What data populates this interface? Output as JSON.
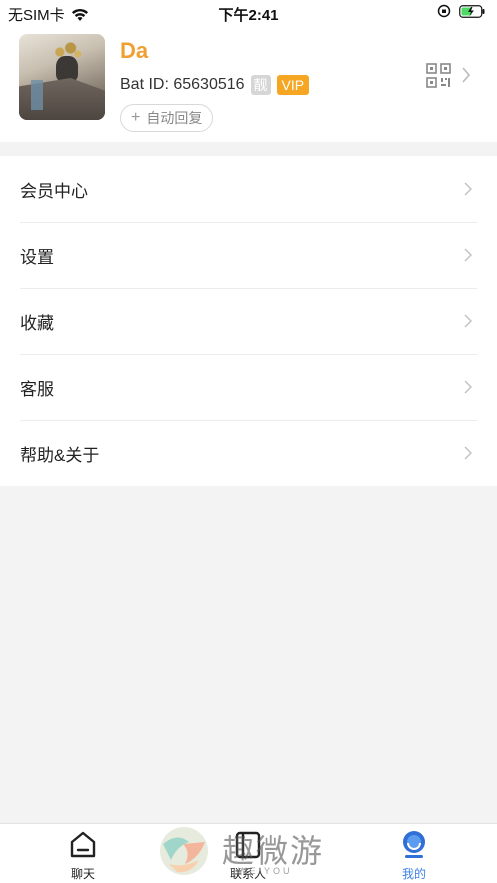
{
  "status_bar": {
    "carrier": "无SIM卡",
    "time": "下午2:41"
  },
  "profile": {
    "name": "Da",
    "id_text": "Bat ID: 65630516",
    "badge_liang": "靓",
    "badge_vip": "VIP",
    "auto_reply_label": "自动回复"
  },
  "menu": {
    "items": [
      {
        "label": "会员中心"
      },
      {
        "label": "设置"
      },
      {
        "label": "收藏"
      },
      {
        "label": "客服"
      },
      {
        "label": "帮助&关于"
      }
    ]
  },
  "tab_bar": {
    "tabs": [
      {
        "label": "聊天",
        "icon": "home-icon"
      },
      {
        "label": "联系人",
        "icon": "contacts-icon"
      },
      {
        "label": "我的",
        "icon": "profile-icon"
      }
    ],
    "active_tab": "我的",
    "active_color": "#3e82e8"
  },
  "watermark": {
    "text": "趣微游",
    "sub": "WEIYOU"
  },
  "colors": {
    "name": "#f0a030",
    "vip": "#f5a623"
  }
}
